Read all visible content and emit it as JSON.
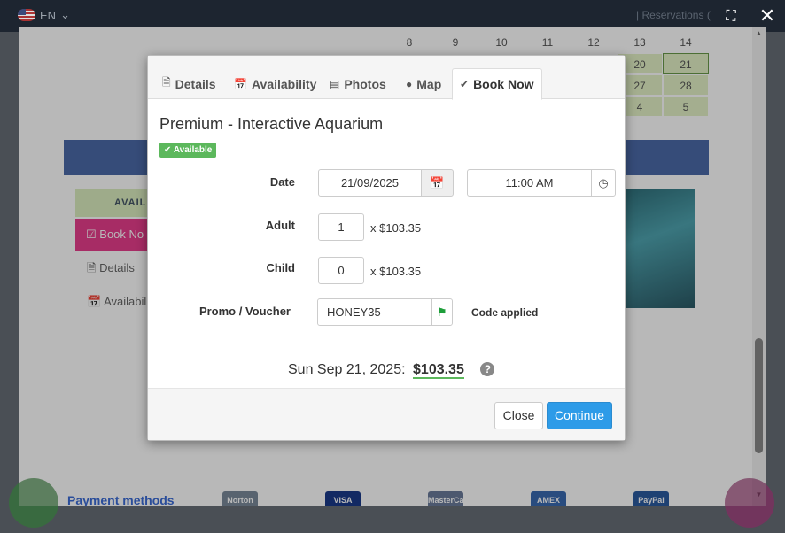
{
  "topbar": {
    "language": "EN",
    "reservations_label": "| Reservations (",
    "fullscreen_icon": "fullscreen-icon",
    "close_icon": "close-icon"
  },
  "background_page": {
    "calendar": {
      "row1": [
        "8",
        "9",
        "10",
        "11",
        "12",
        "13",
        "14"
      ],
      "row2": [
        "",
        "",
        "",
        "",
        "",
        "20",
        "21"
      ],
      "row3": [
        "",
        "",
        "",
        "",
        "",
        "27",
        "28"
      ],
      "row4": [
        "",
        "",
        "",
        "",
        "",
        "4",
        "5"
      ]
    },
    "availability_tab": "AVAIL",
    "book_now_side": "Book No",
    "details_link": "Details",
    "availability_link": "Availabili",
    "payment_methods": "Payment methods",
    "payment_logos": [
      "Norton",
      "VISA",
      "MasterCard",
      "AMEX",
      "PayPal"
    ]
  },
  "modal": {
    "tabs": [
      {
        "label": "Details",
        "icon": "document-icon"
      },
      {
        "label": "Availability",
        "icon": "calendar-icon"
      },
      {
        "label": "Photos",
        "icon": "image-icon"
      },
      {
        "label": "Map",
        "icon": "map-marker-icon"
      },
      {
        "label": "Book Now",
        "icon": "check-icon"
      }
    ],
    "title": "Premium - Interactive Aquarium",
    "status_badge": "Available",
    "date_label": "Date",
    "date_value": "21/09/2025",
    "time_value": "11:00 AM",
    "adult_label": "Adult",
    "adult_qty": "1",
    "adult_price": "x $103.35",
    "child_label": "Child",
    "child_qty": "0",
    "child_price": "x $103.35",
    "promo_label": "Promo / Voucher",
    "promo_value": "HONEY35",
    "promo_status": "Code applied",
    "total_date": "Sun Sep 21, 2025:",
    "total_amount": "$103.35",
    "close_button": "Close",
    "continue_button": "Continue"
  },
  "colors": {
    "primary": "#2d9be8",
    "success": "#5cb85c",
    "accent_pink": "#e83e8c"
  }
}
